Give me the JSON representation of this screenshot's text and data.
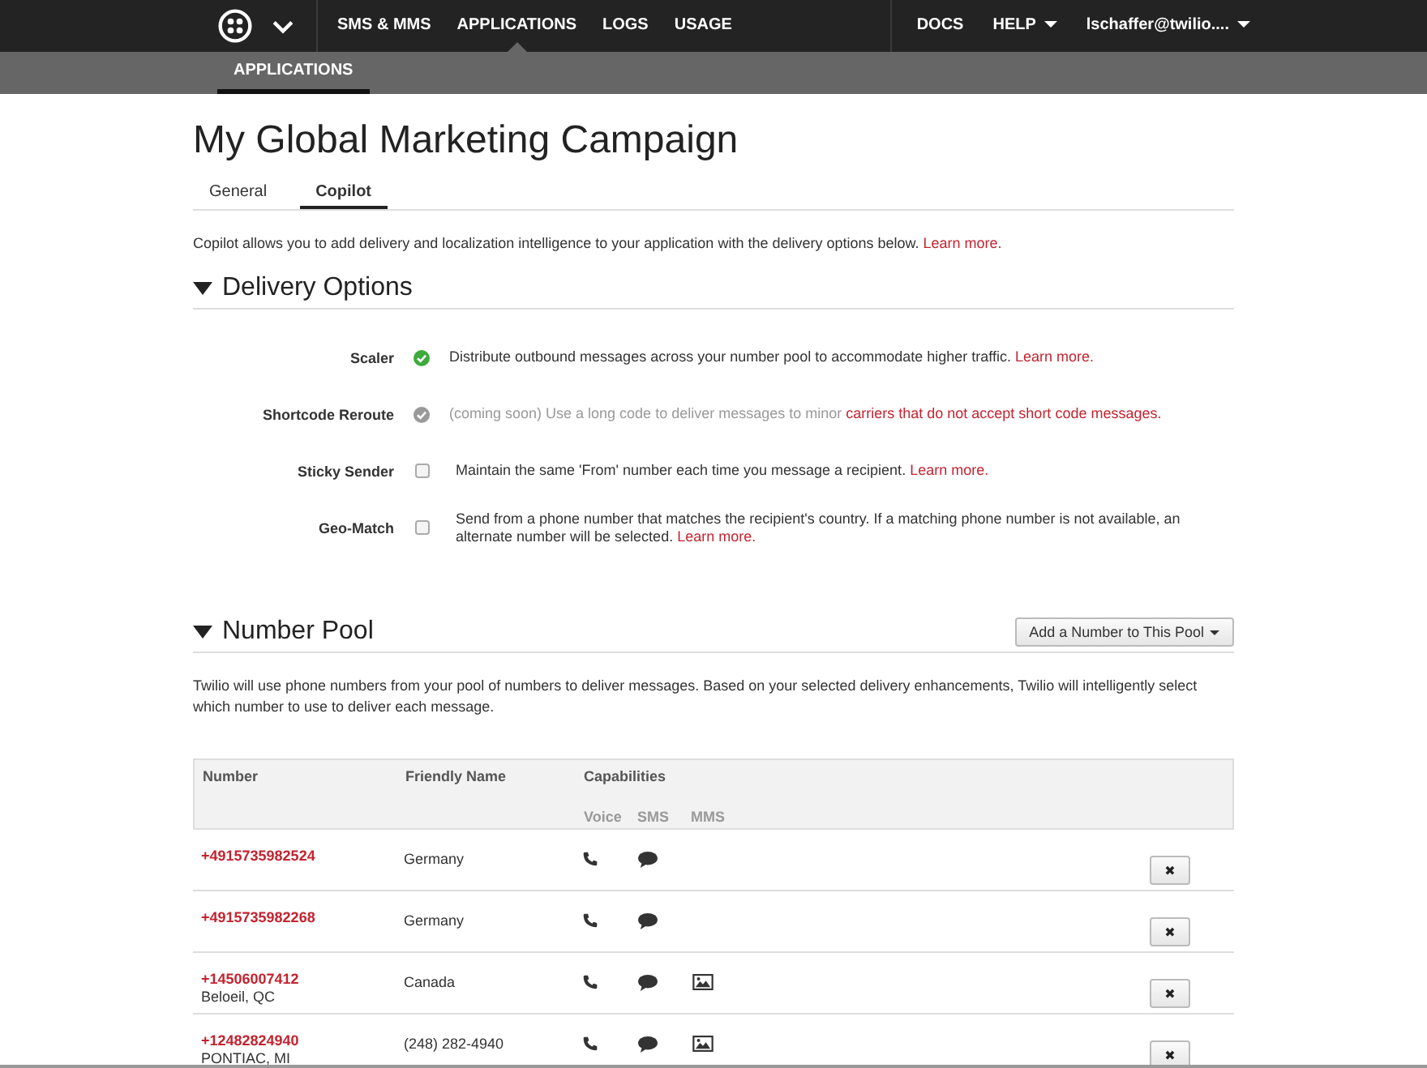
{
  "topnav": {
    "items": [
      {
        "label": "SMS & MMS",
        "selected": false
      },
      {
        "label": "APPLICATIONS",
        "selected": true
      },
      {
        "label": "LOGS",
        "selected": false
      },
      {
        "label": "USAGE",
        "selected": false
      }
    ],
    "right": [
      {
        "label": "DOCS",
        "dropdown": false
      },
      {
        "label": "HELP",
        "dropdown": true
      },
      {
        "label": "lschaffer@twilio....",
        "dropdown": true
      }
    ]
  },
  "subnav": [
    {
      "label": "APPLICATIONS",
      "selected": true
    }
  ],
  "title": "My Global Marketing Campaign",
  "tabs": [
    {
      "label": "General",
      "selected": false
    },
    {
      "label": "Copilot",
      "selected": true
    }
  ],
  "intro": {
    "text": "Copilot allows you to add delivery and localization intelligence to your application with the delivery options below.",
    "link": "Learn more."
  },
  "delivery": {
    "heading": "Delivery Options",
    "expanded": true,
    "options": [
      {
        "label": "Scaler",
        "kind": "status",
        "on": true,
        "disabled": false,
        "text": "Distribute outbound messages across your number pool to accommodate higher traffic.",
        "link": "Learn more."
      },
      {
        "label": "Shortcode Reroute",
        "kind": "status",
        "on": false,
        "disabled": true,
        "text": "(coming soon) Use a long code to deliver messages to minor",
        "link": "carriers that do not accept short code messages."
      },
      {
        "label": "Sticky Sender",
        "kind": "checkbox",
        "checked": false,
        "disabled": false,
        "text": "Maintain the same 'From' number each time you message a recipient.",
        "link": "Learn more."
      },
      {
        "label": "Geo-Match",
        "kind": "checkbox",
        "checked": false,
        "disabled": false,
        "text": "Send from a phone number that matches the recipient's country. If a matching phone number is not available, an alternate number will be selected.",
        "link": "Learn more."
      }
    ]
  },
  "pool": {
    "heading": "Number Pool",
    "expanded": true,
    "button": "Add a Number to This Pool",
    "text": "Twilio will use phone numbers from your pool of numbers to deliver messages. Based on your selected delivery enhancements, Twilio will intelligently select which number to use to deliver each message.",
    "columns": [
      "Number",
      "Friendly Name",
      "Capabilities"
    ],
    "capabilities": [
      "Voice",
      "SMS",
      "MMS"
    ],
    "rows": [
      {
        "number": "+4915735982524",
        "friendly_name": "Germany",
        "voice": true,
        "sms": true,
        "mms": false,
        "delete": "✖"
      },
      {
        "number": "+4915735982268",
        "friendly_name": "Germany",
        "voice": true,
        "sms": true,
        "mms": false,
        "delete": "✖"
      },
      {
        "number": "+14506007412",
        "location": "Beloeil, QC",
        "friendly_name": "Canada",
        "voice": true,
        "sms": true,
        "mms": true,
        "delete": "✖"
      },
      {
        "number": "+12482824940",
        "location": "PONTIAC, MI",
        "friendly_name": "(248) 282-4940",
        "voice": true,
        "sms": true,
        "mms": true,
        "delete": "✖"
      }
    ]
  }
}
